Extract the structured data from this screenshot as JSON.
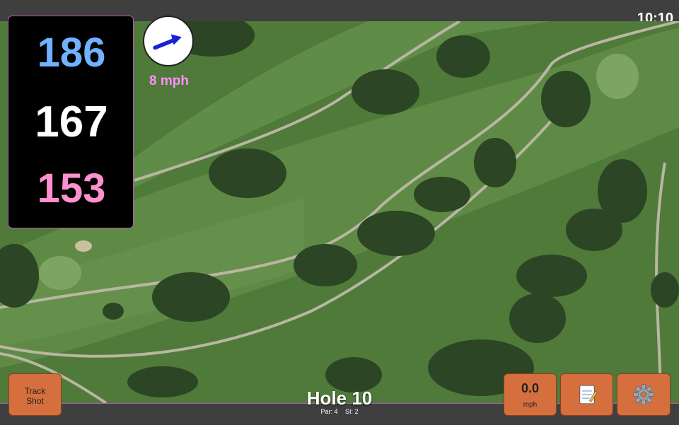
{
  "status": {
    "time": "10:10"
  },
  "distances": {
    "back": "186",
    "middle": "167",
    "front": "153"
  },
  "wind": {
    "speed_label": "8 mph",
    "direction_icon": "arrow-icon"
  },
  "buttons": {
    "track_shot_line1": "Track",
    "track_shot_line2": "Shot",
    "speed_value": "0.0",
    "speed_unit": "mph",
    "notes_icon": "notepad-icon",
    "settings_icon": "gear-icon"
  },
  "hole": {
    "title": "Hole 10",
    "par": "Par: 4",
    "si": "SI: 2"
  },
  "colors": {
    "back": "#6fb2ff",
    "middle": "#ffffff",
    "front": "#ff8fce",
    "accent": "#b35cb0",
    "button": "#d56f3e"
  }
}
